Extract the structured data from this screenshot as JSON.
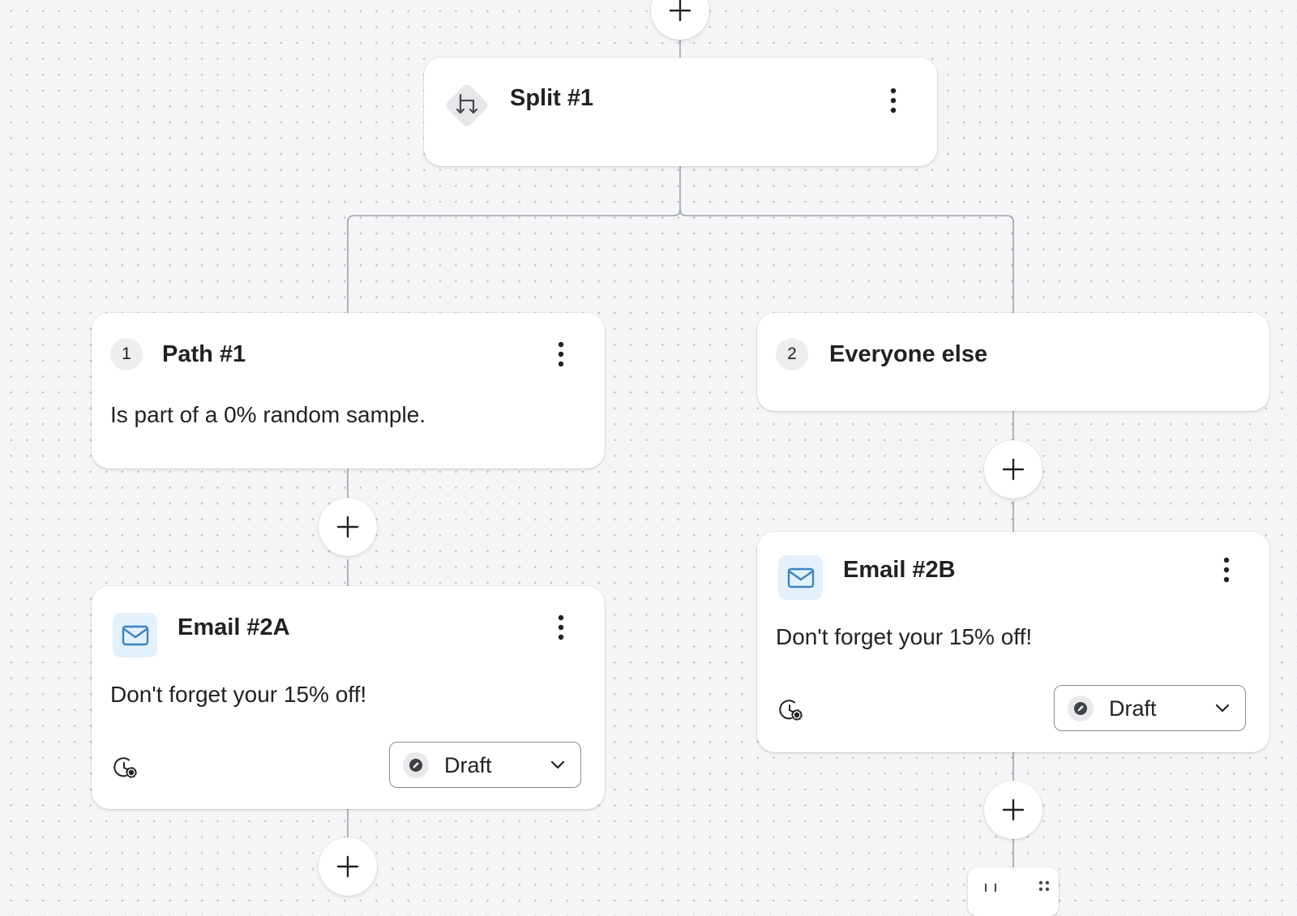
{
  "split": {
    "title": "Split #1"
  },
  "paths": [
    {
      "number": "1",
      "title": "Path #1",
      "condition": "Is part of a 0% random sample."
    },
    {
      "number": "2",
      "title": "Everyone else"
    }
  ],
  "emails": [
    {
      "title": "Email #2A",
      "subject": "Don't forget your 15% off!",
      "status": "Draft"
    },
    {
      "title": "Email #2B",
      "subject": "Don't forget your 15% off!",
      "status": "Draft"
    }
  ],
  "colors": {
    "accent": "#3b82c4",
    "icon_bg": "#e3f1fd",
    "canvas": "#f4f5f7"
  },
  "icons": [
    "plus-icon",
    "split-icon",
    "more-vertical-icon",
    "mail-icon",
    "timing-settings-icon",
    "pencil-icon",
    "chevron-down-icon"
  ]
}
